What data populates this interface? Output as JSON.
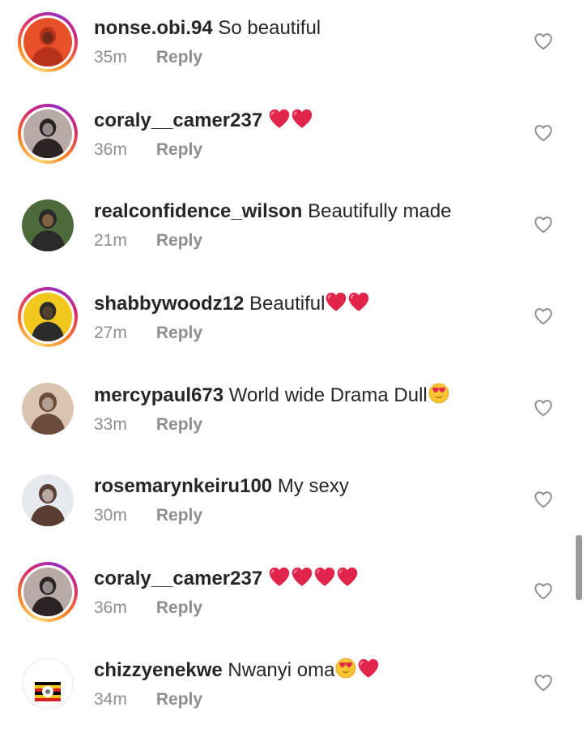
{
  "comments": [
    {
      "username": "nonse.obi.94",
      "text": "So beautiful",
      "hearts": 0,
      "face": false,
      "face_after_text": false,
      "time": "35m",
      "reply": "Reply",
      "avatar_ring": true,
      "avatar_colors": [
        "#e8502a",
        "#b8321a",
        "#3a2218"
      ]
    },
    {
      "username": "coraly__camer237",
      "text": "",
      "hearts": 2,
      "face": false,
      "face_after_text": false,
      "time": "36m",
      "reply": "Reply",
      "avatar_ring": true,
      "avatar_colors": [
        "#b8aaa6",
        "#2b2324",
        "#e8e2e0"
      ]
    },
    {
      "username": "realconfidence_wilson",
      "text": "Beautifully made",
      "hearts": 0,
      "face": false,
      "face_after_text": false,
      "time": "21m",
      "reply": "Reply",
      "avatar_ring": false,
      "avatar_colors": [
        "#4d6b3a",
        "#2a2a2a",
        "#c98d5a"
      ]
    },
    {
      "username": "shabbywoodz12",
      "text": "Beautiful",
      "hearts": 2,
      "face": false,
      "face_after_text": false,
      "time": "27m",
      "reply": "Reply",
      "avatar_ring": true,
      "avatar_colors": [
        "#f2c81e",
        "#2b2b2b",
        "#7a5030"
      ]
    },
    {
      "username": "mercypaul673",
      "text": "World wide Drama Dull",
      "hearts": 0,
      "face": true,
      "face_after_text": true,
      "time": "33m",
      "reply": "Reply",
      "avatar_ring": false,
      "avatar_colors": [
        "#d9c4b0",
        "#6b4b3a",
        "#f1e6dc"
      ]
    },
    {
      "username": "rosemarynkeiru100",
      "text": "My sexy",
      "hearts": 0,
      "face": false,
      "face_after_text": false,
      "time": "30m",
      "reply": "Reply",
      "avatar_ring": false,
      "avatar_colors": [
        "#e6e9ee",
        "#5a3d32",
        "#ffffff"
      ]
    },
    {
      "username": "coraly__camer237",
      "text": "",
      "hearts": 4,
      "face": false,
      "face_after_text": false,
      "time": "36m",
      "reply": "Reply",
      "avatar_ring": true,
      "avatar_colors": [
        "#b8aaa6",
        "#2b2324",
        "#e8e2e0"
      ]
    },
    {
      "username": "chizzyenekwe",
      "text": "Nwanyi oma",
      "hearts": 1,
      "face": true,
      "face_after_text": true,
      "time": "34m",
      "reply": "Reply",
      "avatar_ring": false,
      "avatar_colors": [
        "#ffffff",
        "#000000",
        "#f0c419"
      ],
      "avatar_lettering": [
        "LIVE GAINS",
        "@FINESTSAM"
      ]
    }
  ],
  "colors": {
    "text": "#262626",
    "secondary": "#8e8e8e",
    "heart": "#e0244a",
    "like_outline": "#8e8e8e"
  },
  "icons": {
    "like": "heart-outline-icon",
    "emoji_heart": "red-heart-emoji",
    "emoji_face": "heart-eyes-face-emoji"
  }
}
